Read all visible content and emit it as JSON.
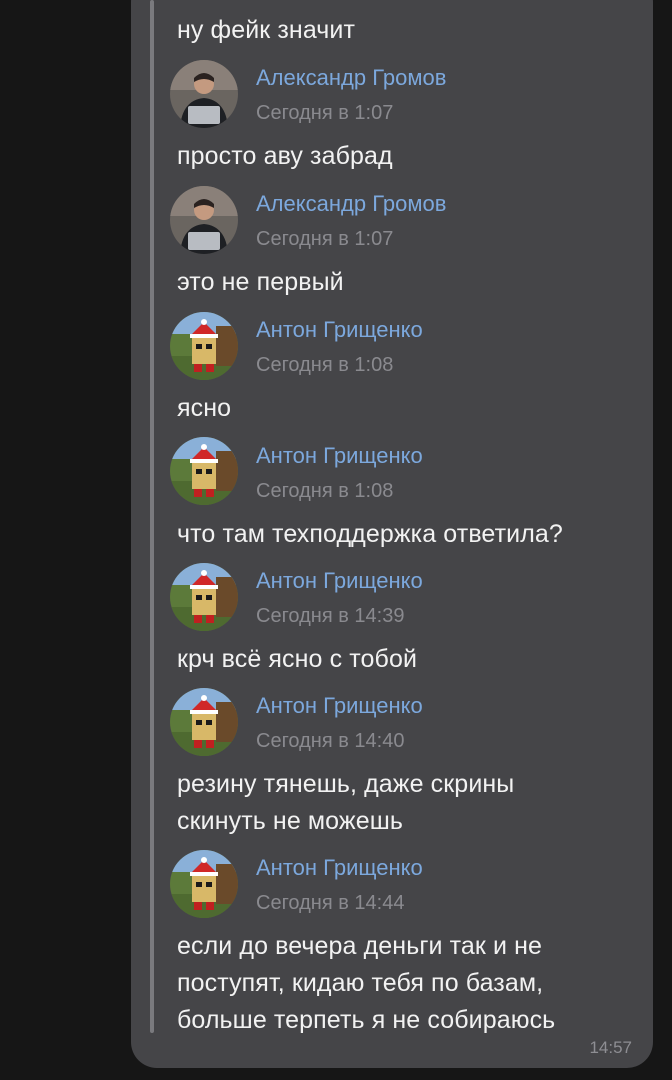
{
  "messages": [
    {
      "author": "",
      "date": "",
      "lines": [
        "ну фейк значит"
      ]
    },
    {
      "author": "Александр Громов",
      "date": "Сегодня в 1:07",
      "avatar": "person-avatar",
      "lines": [
        "просто аву забрад"
      ]
    },
    {
      "author": "Александр Громов",
      "date": "Сегодня в 1:07",
      "avatar": "person-avatar",
      "lines": [
        "это не первый"
      ]
    },
    {
      "author": "Антон Грищенко",
      "date": "Сегодня в 1:08",
      "avatar": "game-character-avatar",
      "lines": [
        "ясно"
      ]
    },
    {
      "author": "Антон Грищенко",
      "date": "Сегодня в 1:08",
      "avatar": "game-character-avatar",
      "lines": [
        "что там техподдержка ответила?"
      ]
    },
    {
      "author": "Антон Грищенко",
      "date": "Сегодня в 14:39",
      "avatar": "game-character-avatar",
      "lines": [
        "крч всё ясно с тобой"
      ]
    },
    {
      "author": "Антон Грищенко",
      "date": "Сегодня в 14:40",
      "avatar": "game-character-avatar",
      "lines": [
        "резину тянешь, даже скрины",
        "скинуть не можешь"
      ]
    },
    {
      "author": "Антон Грищенко",
      "date": "Сегодня в 14:44",
      "avatar": "game-character-avatar",
      "lines": [
        "если до вечера деньги так и не",
        "поступят, кидаю тебя по базам,",
        "больше терпеть я не собираюсь"
      ]
    }
  ],
  "bubble_time": "14:57",
  "colors": {
    "background": "#161616",
    "bubble": "#454548",
    "author": "#7ca8dd",
    "date": "#8a8a8f",
    "text": "#f2f2f2",
    "forward_line": "#7a7a7e"
  }
}
